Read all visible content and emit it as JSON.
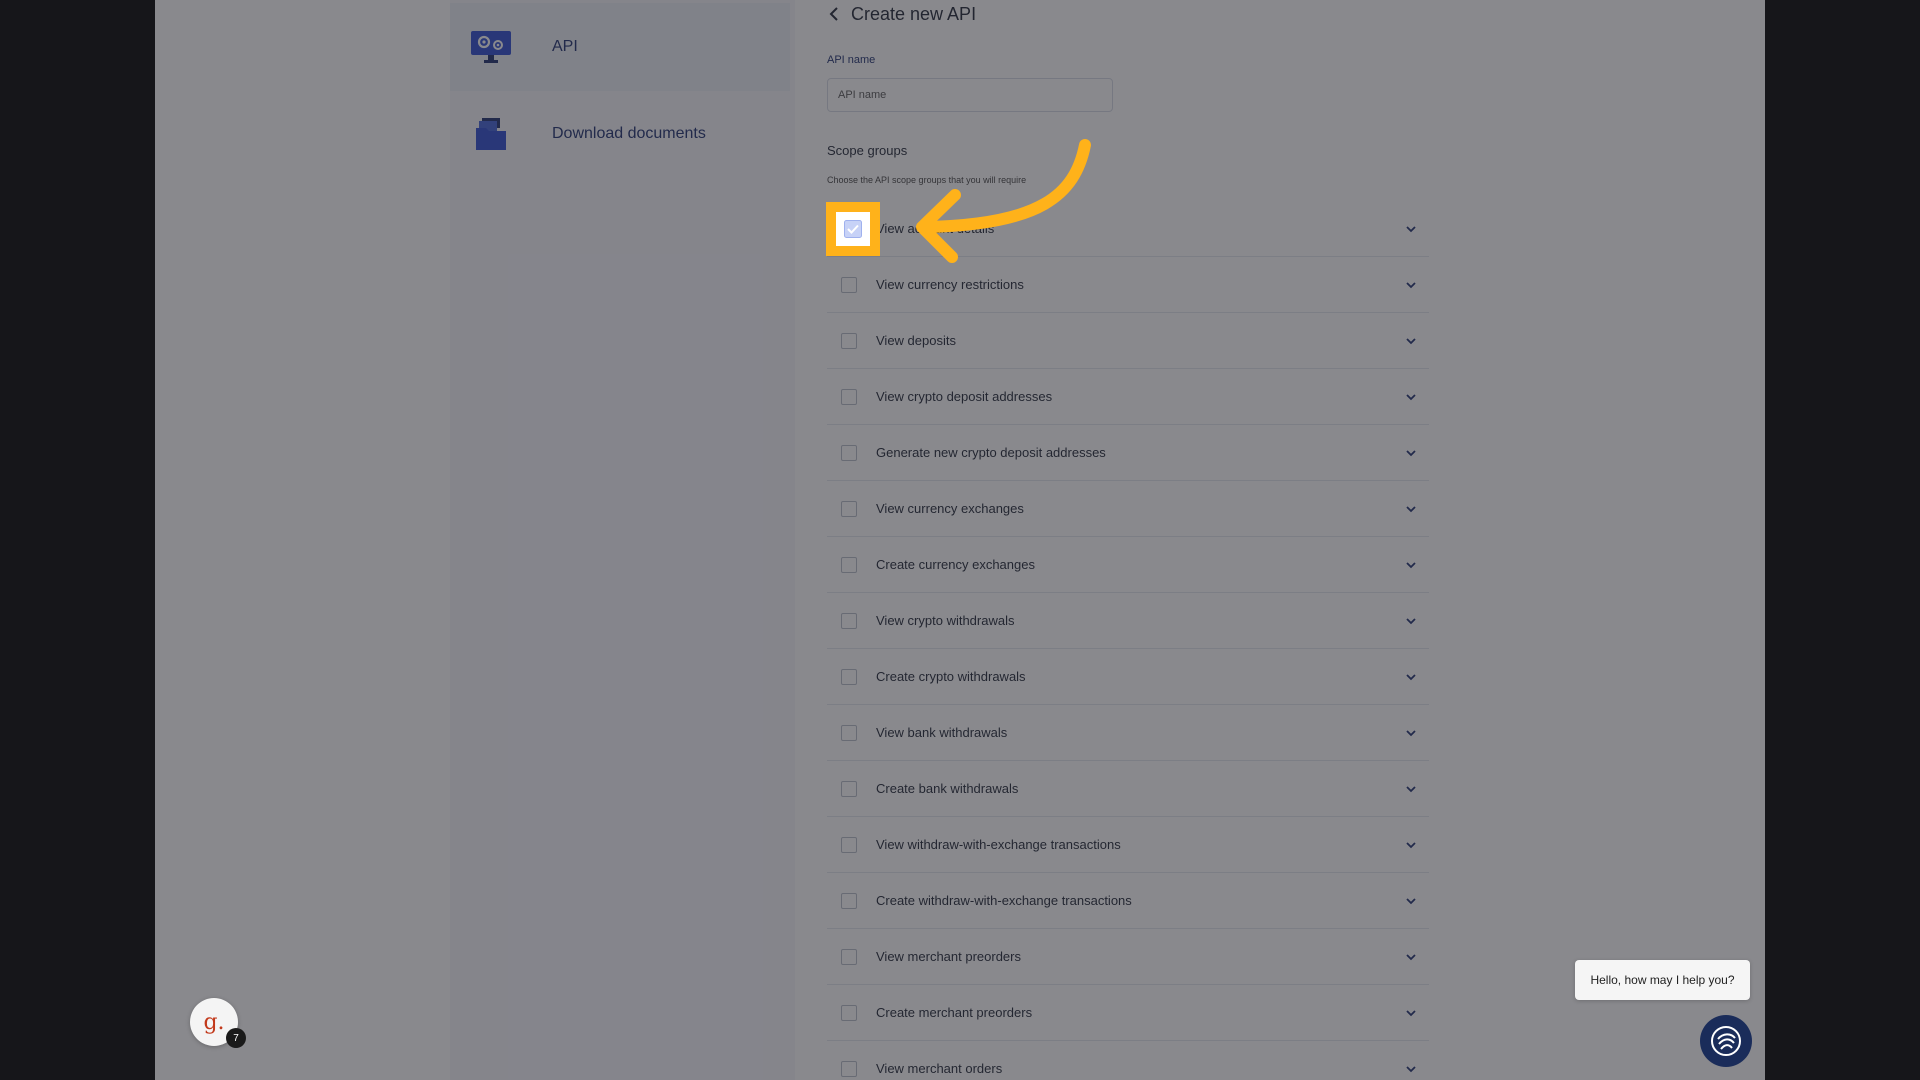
{
  "sidebar": {
    "items": [
      {
        "label": "API",
        "icon": "api-settings-icon",
        "active": true
      },
      {
        "label": "Download documents",
        "icon": "documents-folder-icon",
        "active": false
      }
    ]
  },
  "header": {
    "title": "Create new API",
    "back_icon": "chevron-left-icon"
  },
  "form": {
    "api_name_label": "API name",
    "api_name_placeholder": "API name",
    "api_name_value": "",
    "scope_title": "Scope groups",
    "scope_hint": "Choose the API scope groups that you will require"
  },
  "scopes": [
    {
      "label": "View account details",
      "checked": true
    },
    {
      "label": "View currency restrictions",
      "checked": false
    },
    {
      "label": "View deposits",
      "checked": false
    },
    {
      "label": "View crypto deposit addresses",
      "checked": false
    },
    {
      "label": "Generate new crypto deposit addresses",
      "checked": false
    },
    {
      "label": "View currency exchanges",
      "checked": false
    },
    {
      "label": "Create currency exchanges",
      "checked": false
    },
    {
      "label": "View crypto withdrawals",
      "checked": false
    },
    {
      "label": "Create crypto withdrawals",
      "checked": false
    },
    {
      "label": "View bank withdrawals",
      "checked": false
    },
    {
      "label": "Create bank withdrawals",
      "checked": false
    },
    {
      "label": "View withdraw-with-exchange transactions",
      "checked": false
    },
    {
      "label": "Create withdraw-with-exchange transactions",
      "checked": false
    },
    {
      "label": "View merchant preorders",
      "checked": false
    },
    {
      "label": "Create merchant preorders",
      "checked": false
    },
    {
      "label": "View merchant orders",
      "checked": false
    }
  ],
  "chat": {
    "greeting": "Hello, how may I help you?",
    "icon": "chat-assistant-icon"
  },
  "guru": {
    "letter": "g.",
    "count": "7"
  },
  "colors": {
    "accent": "#2b56d8",
    "brand_navy": "#1c2e6e",
    "highlight": "#ffb21a"
  }
}
